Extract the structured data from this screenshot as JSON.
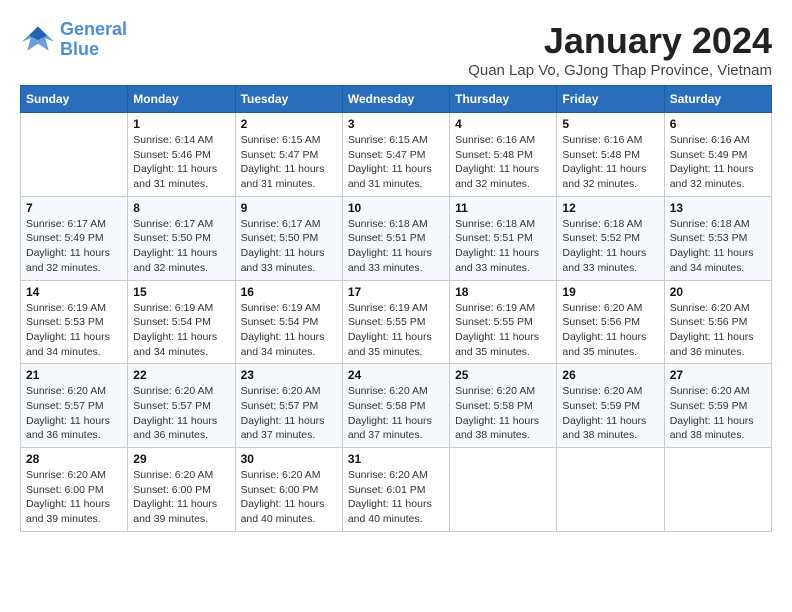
{
  "header": {
    "logo_line1": "General",
    "logo_line2": "Blue",
    "month_title": "January 2024",
    "location": "Quan Lap Vo, GJong Thap Province, Vietnam"
  },
  "days_of_week": [
    "Sunday",
    "Monday",
    "Tuesday",
    "Wednesday",
    "Thursday",
    "Friday",
    "Saturday"
  ],
  "weeks": [
    [
      {
        "day": "",
        "info": ""
      },
      {
        "day": "1",
        "info": "Sunrise: 6:14 AM\nSunset: 5:46 PM\nDaylight: 11 hours\nand 31 minutes."
      },
      {
        "day": "2",
        "info": "Sunrise: 6:15 AM\nSunset: 5:47 PM\nDaylight: 11 hours\nand 31 minutes."
      },
      {
        "day": "3",
        "info": "Sunrise: 6:15 AM\nSunset: 5:47 PM\nDaylight: 11 hours\nand 31 minutes."
      },
      {
        "day": "4",
        "info": "Sunrise: 6:16 AM\nSunset: 5:48 PM\nDaylight: 11 hours\nand 32 minutes."
      },
      {
        "day": "5",
        "info": "Sunrise: 6:16 AM\nSunset: 5:48 PM\nDaylight: 11 hours\nand 32 minutes."
      },
      {
        "day": "6",
        "info": "Sunrise: 6:16 AM\nSunset: 5:49 PM\nDaylight: 11 hours\nand 32 minutes."
      }
    ],
    [
      {
        "day": "7",
        "info": "Sunrise: 6:17 AM\nSunset: 5:49 PM\nDaylight: 11 hours\nand 32 minutes."
      },
      {
        "day": "8",
        "info": "Sunrise: 6:17 AM\nSunset: 5:50 PM\nDaylight: 11 hours\nand 32 minutes."
      },
      {
        "day": "9",
        "info": "Sunrise: 6:17 AM\nSunset: 5:50 PM\nDaylight: 11 hours\nand 33 minutes."
      },
      {
        "day": "10",
        "info": "Sunrise: 6:18 AM\nSunset: 5:51 PM\nDaylight: 11 hours\nand 33 minutes."
      },
      {
        "day": "11",
        "info": "Sunrise: 6:18 AM\nSunset: 5:51 PM\nDaylight: 11 hours\nand 33 minutes."
      },
      {
        "day": "12",
        "info": "Sunrise: 6:18 AM\nSunset: 5:52 PM\nDaylight: 11 hours\nand 33 minutes."
      },
      {
        "day": "13",
        "info": "Sunrise: 6:18 AM\nSunset: 5:53 PM\nDaylight: 11 hours\nand 34 minutes."
      }
    ],
    [
      {
        "day": "14",
        "info": "Sunrise: 6:19 AM\nSunset: 5:53 PM\nDaylight: 11 hours\nand 34 minutes."
      },
      {
        "day": "15",
        "info": "Sunrise: 6:19 AM\nSunset: 5:54 PM\nDaylight: 11 hours\nand 34 minutes."
      },
      {
        "day": "16",
        "info": "Sunrise: 6:19 AM\nSunset: 5:54 PM\nDaylight: 11 hours\nand 34 minutes."
      },
      {
        "day": "17",
        "info": "Sunrise: 6:19 AM\nSunset: 5:55 PM\nDaylight: 11 hours\nand 35 minutes."
      },
      {
        "day": "18",
        "info": "Sunrise: 6:19 AM\nSunset: 5:55 PM\nDaylight: 11 hours\nand 35 minutes."
      },
      {
        "day": "19",
        "info": "Sunrise: 6:20 AM\nSunset: 5:56 PM\nDaylight: 11 hours\nand 35 minutes."
      },
      {
        "day": "20",
        "info": "Sunrise: 6:20 AM\nSunset: 5:56 PM\nDaylight: 11 hours\nand 36 minutes."
      }
    ],
    [
      {
        "day": "21",
        "info": "Sunrise: 6:20 AM\nSunset: 5:57 PM\nDaylight: 11 hours\nand 36 minutes."
      },
      {
        "day": "22",
        "info": "Sunrise: 6:20 AM\nSunset: 5:57 PM\nDaylight: 11 hours\nand 36 minutes."
      },
      {
        "day": "23",
        "info": "Sunrise: 6:20 AM\nSunset: 5:57 PM\nDaylight: 11 hours\nand 37 minutes."
      },
      {
        "day": "24",
        "info": "Sunrise: 6:20 AM\nSunset: 5:58 PM\nDaylight: 11 hours\nand 37 minutes."
      },
      {
        "day": "25",
        "info": "Sunrise: 6:20 AM\nSunset: 5:58 PM\nDaylight: 11 hours\nand 38 minutes."
      },
      {
        "day": "26",
        "info": "Sunrise: 6:20 AM\nSunset: 5:59 PM\nDaylight: 11 hours\nand 38 minutes."
      },
      {
        "day": "27",
        "info": "Sunrise: 6:20 AM\nSunset: 5:59 PM\nDaylight: 11 hours\nand 38 minutes."
      }
    ],
    [
      {
        "day": "28",
        "info": "Sunrise: 6:20 AM\nSunset: 6:00 PM\nDaylight: 11 hours\nand 39 minutes."
      },
      {
        "day": "29",
        "info": "Sunrise: 6:20 AM\nSunset: 6:00 PM\nDaylight: 11 hours\nand 39 minutes."
      },
      {
        "day": "30",
        "info": "Sunrise: 6:20 AM\nSunset: 6:00 PM\nDaylight: 11 hours\nand 40 minutes."
      },
      {
        "day": "31",
        "info": "Sunrise: 6:20 AM\nSunset: 6:01 PM\nDaylight: 11 hours\nand 40 minutes."
      },
      {
        "day": "",
        "info": ""
      },
      {
        "day": "",
        "info": ""
      },
      {
        "day": "",
        "info": ""
      }
    ]
  ]
}
